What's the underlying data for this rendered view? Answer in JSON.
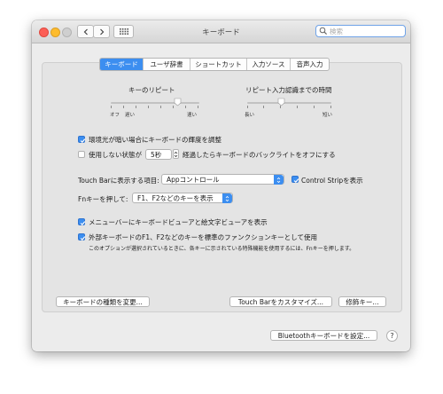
{
  "window": {
    "title": "キーボード"
  },
  "search": {
    "placeholder": "検索"
  },
  "tabs": [
    {
      "label": "キーボード",
      "active": true
    },
    {
      "label": "ユーザ辞書"
    },
    {
      "label": "ショートカット"
    },
    {
      "label": "入力ソース"
    },
    {
      "label": "音声入力"
    }
  ],
  "sliders": {
    "repeat": {
      "label": "キーのリピート",
      "left_caps": [
        "オフ",
        "遅い"
      ],
      "right_cap": "速い"
    },
    "delay": {
      "label": "リピート入力認識までの時間",
      "left_cap": "長い",
      "right_cap": "短い"
    }
  },
  "options": {
    "ambient_light": {
      "label": "環境光が暗い場合にキーボードの輝度を調整",
      "checked": true
    },
    "backlight_off_prefix": {
      "label": "使用しない状態が",
      "checked": false
    },
    "backlight_duration": "5秒",
    "backlight_off_suffix": "経過したらキーボードのバックライトをオフにする",
    "touchbar_label": "Touch Barに表示する項目:",
    "touchbar_value": "Appコントロール",
    "control_strip": {
      "label": "Control Stripを表示",
      "checked": true
    },
    "fn_label": "Fnキーを押して:",
    "fn_value": "F1、F2などのキーを表示",
    "menubar_viewer": {
      "label": "メニューバーにキーボードビューアと絵文字ビューアを表示",
      "checked": true
    },
    "fn_standard": {
      "label": "外部キーボードのF1、F2などのキーを標準のファンクションキーとして使用",
      "checked": true
    },
    "fn_standard_note": "このオプションが選択されているときに、各キーに示されている特殊機能を使用するには、Fnキーを押します。"
  },
  "buttons": {
    "change_type": "キーボードの種類を変更...",
    "customize_touchbar": "Touch Barをカスタマイズ...",
    "modifier_keys": "修飾キー...",
    "bluetooth": "Bluetoothキーボードを設定...",
    "help": "?"
  },
  "colors": {
    "accent": "#3c8ef0",
    "close": "#fc5f57",
    "minimize": "#fdbc2e"
  }
}
